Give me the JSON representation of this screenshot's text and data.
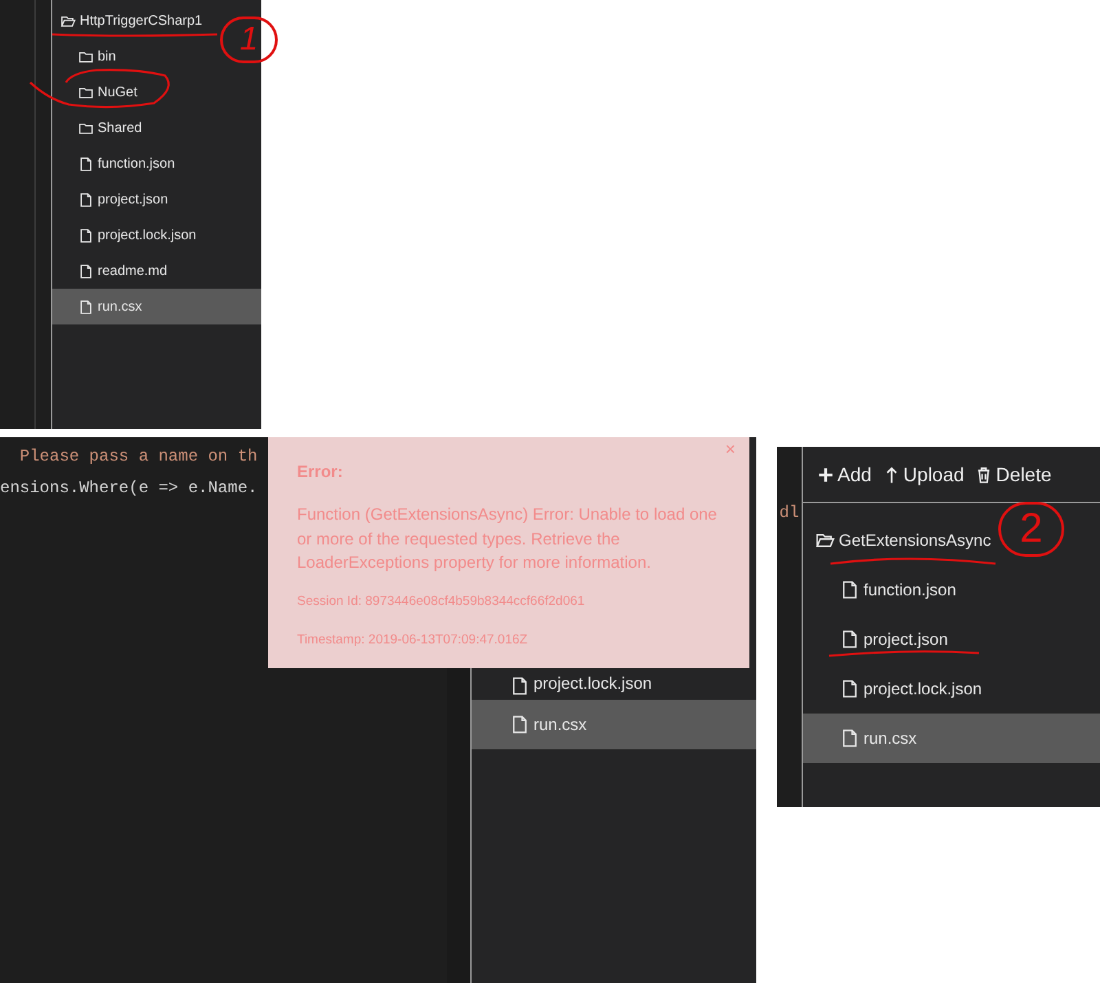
{
  "panel_1": {
    "tree": {
      "label": "HttpTriggerCSharp1",
      "kind": "open_folder",
      "selected": false,
      "children": [
        {
          "label": "bin",
          "kind": "folder",
          "selected": false
        },
        {
          "label": "NuGet",
          "kind": "folder",
          "selected": false
        },
        {
          "label": "Shared",
          "kind": "folder",
          "selected": false
        },
        {
          "label": "function.json",
          "kind": "file",
          "selected": false
        },
        {
          "label": "project.json",
          "kind": "file",
          "selected": false
        },
        {
          "label": "project.lock.json",
          "kind": "file",
          "selected": false
        },
        {
          "label": "readme.md",
          "kind": "file",
          "selected": false
        },
        {
          "label": "run.csx",
          "kind": "file",
          "selected": true
        }
      ]
    },
    "annotation": {
      "number": "1"
    }
  },
  "panel_2": {
    "code_lines": [
      {
        "text": "  Please pass a name on th",
        "kind": "string"
      },
      {
        "text": "ensions.Where(e => e.Name.",
        "kind": "code"
      }
    ],
    "files": [
      {
        "label": "project.lock.json",
        "kind": "file",
        "selected": false
      },
      {
        "label": "run.csx",
        "kind": "file",
        "selected": true
      }
    ],
    "error_toast": {
      "close": "×",
      "title": "Error:",
      "message": "Function (GetExtensionsAsync) Error: Unable to load one or more of the requested types. Retrieve the LoaderExceptions property for more information.",
      "session": "Session Id: 8973446e08cf4b59b8344ccf66f2d061",
      "timestamp": "Timestamp: 2019-06-13T07:09:47.016Z"
    }
  },
  "panel_3": {
    "code_lines": [
      {
        "text": "dl",
        "kind": "string"
      }
    ],
    "toolbar": [
      "Add",
      "Upload",
      "Delete"
    ],
    "tree": {
      "label": "GetExtensionsAsync",
      "kind": "open_folder",
      "selected": false,
      "children": [
        {
          "label": "function.json",
          "kind": "file",
          "selected": false
        },
        {
          "label": "project.json",
          "kind": "file",
          "selected": false
        },
        {
          "label": "project.lock.json",
          "kind": "file",
          "selected": false
        },
        {
          "label": "run.csx",
          "kind": "file",
          "selected": true
        }
      ]
    },
    "annotation": {
      "number": "2"
    }
  }
}
